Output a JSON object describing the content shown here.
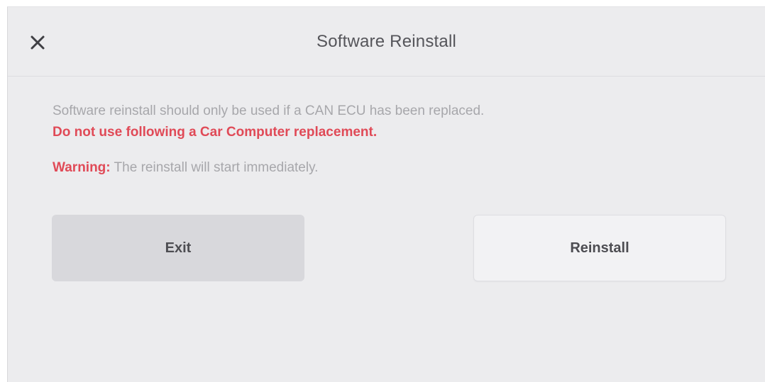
{
  "dialog": {
    "title": "Software Reinstall",
    "close_icon": "close-icon"
  },
  "message": {
    "info": "Software reinstall should only be used if a CAN ECU has been replaced.",
    "danger": "Do not use following a Car Computer replacement.",
    "warning_label": "Warning:",
    "warning_text": " The reinstall will start immediately."
  },
  "buttons": {
    "exit_label": "Exit",
    "reinstall_label": "Reinstall"
  },
  "colors": {
    "background": "#ececee",
    "danger": "#e04a57",
    "muted_text": "#a7a7ab",
    "primary_text": "#4d4d52"
  }
}
